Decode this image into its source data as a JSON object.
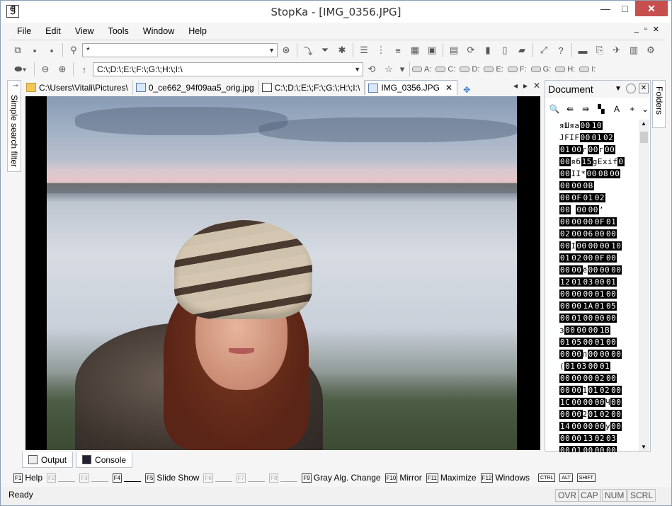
{
  "window": {
    "title": "StopKa - [IMG_0356.JPG]",
    "minimize": "—",
    "maximize": "□",
    "close": "✕"
  },
  "menu": {
    "items": [
      "File",
      "Edit",
      "View",
      "Tools",
      "Window",
      "Help"
    ],
    "mdi": [
      "_",
      "▫",
      "✕"
    ]
  },
  "toolbar1": {
    "filter_value": "*"
  },
  "toolbar2": {
    "path_value": "C:\\;D:\\;E:\\;F:\\;G:\\;H:\\;I:\\",
    "drives": [
      "A:",
      "C:",
      "D:",
      "E:",
      "F:",
      "G:",
      "H:",
      "I:"
    ]
  },
  "tabs": [
    {
      "label": "C:\\Users\\Vitali\\Pictures\\",
      "icon": "folder-icon"
    },
    {
      "label": "0_ce662_94f09aa5_orig.jpg",
      "icon": "image-icon"
    },
    {
      "label": "C:\\;D:\\;E:\\;F:\\;G:\\;H:\\;I:\\",
      "icon": "app-icon"
    },
    {
      "label": "IMG_0356.JPG",
      "icon": "image-icon",
      "active": true
    }
  ],
  "left_panel": {
    "label": "Simple search filter"
  },
  "right_tab": {
    "label": "Folders"
  },
  "document_panel": {
    "title": "Document",
    "hex_rows": [
      [
        [
          "t",
          "яШяа"
        ],
        [
          "b",
          "00"
        ],
        [
          "b",
          "10"
        ]
      ],
      [
        [
          "t",
          "JFIF"
        ],
        [
          "b",
          "00"
        ],
        [
          "b",
          "01"
        ],
        [
          "b",
          "02"
        ]
      ],
      [
        [
          "b",
          "01"
        ],
        [
          "b",
          "00"
        ],
        [
          "t",
          "г"
        ],
        [
          "b",
          "00"
        ],
        [
          "t",
          "г"
        ],
        [
          "b",
          "00"
        ]
      ],
      [
        [
          "b",
          "00"
        ],
        [
          "t",
          "яб"
        ],
        [
          "b",
          "15"
        ],
        [
          "t",
          "gExif"
        ],
        [
          "b",
          "0"
        ]
      ],
      [
        [
          "b",
          "00"
        ],
        [
          "t",
          "II*"
        ],
        [
          "b",
          "00"
        ],
        [
          "b",
          "08"
        ],
        [
          "b",
          "00"
        ]
      ],
      [
        [
          "b",
          "00"
        ],
        [
          "b",
          "00"
        ],
        [
          "b",
          "0B"
        ]
      ],
      [
        [
          "b",
          "00"
        ],
        [
          "b",
          "0F"
        ],
        [
          "b",
          "01"
        ],
        [
          "b",
          "02"
        ]
      ],
      [
        [
          "b",
          "00"
        ],
        [
          "t",
          " "
        ],
        [
          "b",
          "00"
        ],
        [
          "b",
          "00"
        ],
        [
          "t",
          "’"
        ]
      ],
      [
        [
          "b",
          "00"
        ],
        [
          "b",
          "00"
        ],
        [
          "b",
          "00"
        ],
        [
          "b",
          "0F"
        ],
        [
          "b",
          "01"
        ]
      ],
      [
        [
          "b",
          "02"
        ],
        [
          "b",
          "00"
        ],
        [
          "b",
          "06"
        ],
        [
          "b",
          "00"
        ],
        [
          "b",
          "00"
        ]
      ],
      [
        [
          "b",
          "00"
        ],
        [
          "t",
          "I"
        ],
        [
          "b",
          "00"
        ],
        [
          "b",
          "00"
        ],
        [
          "b",
          "00"
        ],
        [
          "b",
          "10"
        ]
      ],
      [
        [
          "b",
          "01"
        ],
        [
          "b",
          "02"
        ],
        [
          "b",
          "00"
        ],
        [
          "b",
          "0F"
        ],
        [
          "b",
          "00"
        ]
      ],
      [
        [
          "b",
          "00"
        ],
        [
          "b",
          "00"
        ],
        [
          "t",
          "ё"
        ],
        [
          "b",
          "00"
        ],
        [
          "b",
          "00"
        ],
        [
          "b",
          "00"
        ]
      ],
      [
        [
          "b",
          "12"
        ],
        [
          "b",
          "01"
        ],
        [
          "b",
          "03"
        ],
        [
          "b",
          "00"
        ],
        [
          "b",
          "01"
        ]
      ],
      [
        [
          "b",
          "00"
        ],
        [
          "b",
          "00"
        ],
        [
          "b",
          "00"
        ],
        [
          "b",
          "01"
        ],
        [
          "b",
          "00"
        ]
      ],
      [
        [
          "b",
          "00"
        ],
        [
          "b",
          "00"
        ],
        [
          "b",
          "1A"
        ],
        [
          "b",
          "01"
        ],
        [
          "b",
          "05"
        ]
      ],
      [
        [
          "b",
          "00"
        ],
        [
          "b",
          "01"
        ],
        [
          "b",
          "00"
        ],
        [
          "b",
          "00"
        ],
        [
          "b",
          "00"
        ]
      ],
      [
        [
          "t",
          "з"
        ],
        [
          "b",
          "00"
        ],
        [
          "b",
          "00"
        ],
        [
          "b",
          "00"
        ],
        [
          "b",
          "1B"
        ]
      ],
      [
        [
          "b",
          "01"
        ],
        [
          "b",
          "05"
        ],
        [
          "b",
          "00"
        ],
        [
          "b",
          "01"
        ],
        [
          "b",
          "00"
        ]
      ],
      [
        [
          "b",
          "00"
        ],
        [
          "b",
          "00"
        ],
        [
          "t",
          "п"
        ],
        [
          "b",
          "00"
        ],
        [
          "b",
          "00"
        ],
        [
          "b",
          "00"
        ]
      ],
      [
        [
          "t",
          "("
        ],
        [
          "b",
          "01"
        ],
        [
          "b",
          "03"
        ],
        [
          "b",
          "00"
        ],
        [
          "b",
          "01"
        ]
      ],
      [
        [
          "b",
          "00"
        ],
        [
          "b",
          "00"
        ],
        [
          "b",
          "00"
        ],
        [
          "b",
          "02"
        ],
        [
          "b",
          "00"
        ]
      ],
      [
        [
          "b",
          "00"
        ],
        [
          "b",
          "00"
        ],
        [
          "t",
          "1"
        ],
        [
          "b",
          "01"
        ],
        [
          "b",
          "02"
        ],
        [
          "b",
          "00"
        ]
      ],
      [
        [
          "b",
          "1C"
        ],
        [
          "b",
          "00"
        ],
        [
          "b",
          "00"
        ],
        [
          "b",
          "00"
        ],
        [
          "t",
          "Ч"
        ],
        [
          "b",
          "00"
        ]
      ],
      [
        [
          "b",
          "00"
        ],
        [
          "b",
          "00"
        ],
        [
          "t",
          "2"
        ],
        [
          "b",
          "01"
        ],
        [
          "b",
          "02"
        ],
        [
          "b",
          "00"
        ]
      ],
      [
        [
          "b",
          "14"
        ],
        [
          "b",
          "00"
        ],
        [
          "b",
          "00"
        ],
        [
          "b",
          "00"
        ],
        [
          "t",
          "у"
        ],
        [
          "b",
          "00"
        ]
      ],
      [
        [
          "b",
          "00"
        ],
        [
          "b",
          "00"
        ],
        [
          "b",
          "13"
        ],
        [
          "b",
          "02"
        ],
        [
          "b",
          "03"
        ]
      ],
      [
        [
          "b",
          "00"
        ],
        [
          "b",
          "01"
        ],
        [
          "b",
          "00"
        ],
        [
          "b",
          "00"
        ],
        [
          "b",
          "00"
        ]
      ]
    ]
  },
  "bottom_tabs": [
    {
      "label": "Output"
    },
    {
      "label": "Console"
    }
  ],
  "fkeys": [
    {
      "key": "F1",
      "label": "Help",
      "enabled": true
    },
    {
      "key": "F2",
      "label": "",
      "enabled": false
    },
    {
      "key": "F3",
      "label": "",
      "enabled": false
    },
    {
      "key": "F4",
      "label": "",
      "enabled": true
    },
    {
      "key": "F5",
      "label": "Slide Show",
      "enabled": true
    },
    {
      "key": "F6",
      "label": "",
      "enabled": false
    },
    {
      "key": "F7",
      "label": "",
      "enabled": false
    },
    {
      "key": "F8",
      "label": "",
      "enabled": false
    },
    {
      "key": "F9",
      "label": "Gray Alg. Change",
      "enabled": true
    },
    {
      "key": "F10",
      "label": "Mirror",
      "enabled": true
    },
    {
      "key": "F11",
      "label": "Maximize",
      "enabled": true
    },
    {
      "key": "F12",
      "label": "Windows",
      "enabled": true
    }
  ],
  "modkeys": [
    "CTRL",
    "ALT",
    "SHIFT"
  ],
  "status": {
    "text": "Ready",
    "indicators": [
      "OVR",
      "CAP",
      "NUM",
      "SCRL"
    ]
  }
}
